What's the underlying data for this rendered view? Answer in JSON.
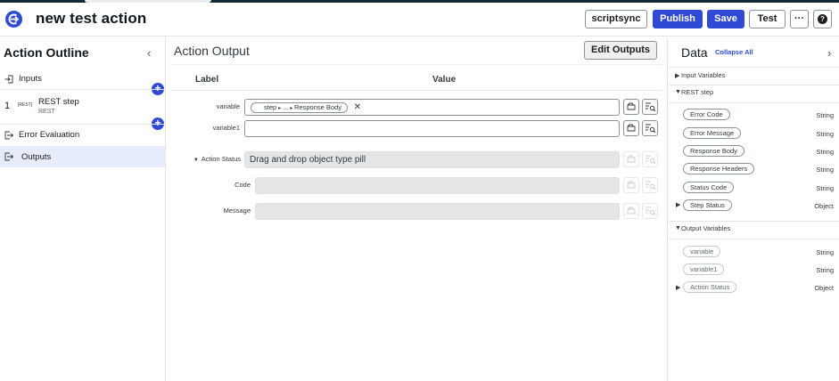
{
  "header": {
    "title": "new test action",
    "buttons": {
      "scriptsync": "scriptsync",
      "publish": "Publish",
      "save": "Save",
      "test": "Test",
      "more": "···",
      "help": "?"
    },
    "colors": {
      "primary": "#2f4bd6",
      "topstrip": "#122a36"
    }
  },
  "outline": {
    "title": "Action Outline",
    "collapse_icon": "chevron-left-icon",
    "items": [
      {
        "label": "Inputs",
        "icon": "inputs-icon"
      },
      {
        "index": "1",
        "badge": "[REST]",
        "label": "REST step",
        "sublabel": "REST"
      },
      {
        "label": "Error Evaluation",
        "icon": "error-evaluation-icon"
      },
      {
        "label": "Outputs",
        "icon": "outputs-icon",
        "selected": true
      }
    ]
  },
  "main": {
    "title": "Action Output",
    "edit_outputs": "Edit Outputs",
    "col_label": "Label",
    "col_value": "Value",
    "rows": [
      {
        "label": "variable",
        "pill": {
          "first": "step",
          "mid": "...",
          "last": "Response Body"
        }
      },
      {
        "label": "variable1"
      },
      {
        "label": "Action Status",
        "placeholder": "Drag and drop object type pill"
      },
      {
        "label": "Code"
      },
      {
        "label": "Message"
      }
    ]
  },
  "data_panel": {
    "title": "Data",
    "collapse_all": "Collapse All",
    "sections": {
      "input_variables": "Input Variables",
      "rest_step": "REST step",
      "output_variables": "Output Variables"
    },
    "rest_items": [
      {
        "name": "Error Code",
        "type": "String"
      },
      {
        "name": "Error Message",
        "type": "String"
      },
      {
        "name": "Response Body",
        "type": "String"
      },
      {
        "name": "Response Headers",
        "type": "String"
      },
      {
        "name": "Status Code",
        "type": "String"
      },
      {
        "name": "Step Status",
        "type": "Object"
      }
    ],
    "output_items": [
      {
        "name": "variable",
        "type": "String"
      },
      {
        "name": "variable1",
        "type": "String"
      },
      {
        "name": "Action Status",
        "type": "Object"
      }
    ]
  }
}
